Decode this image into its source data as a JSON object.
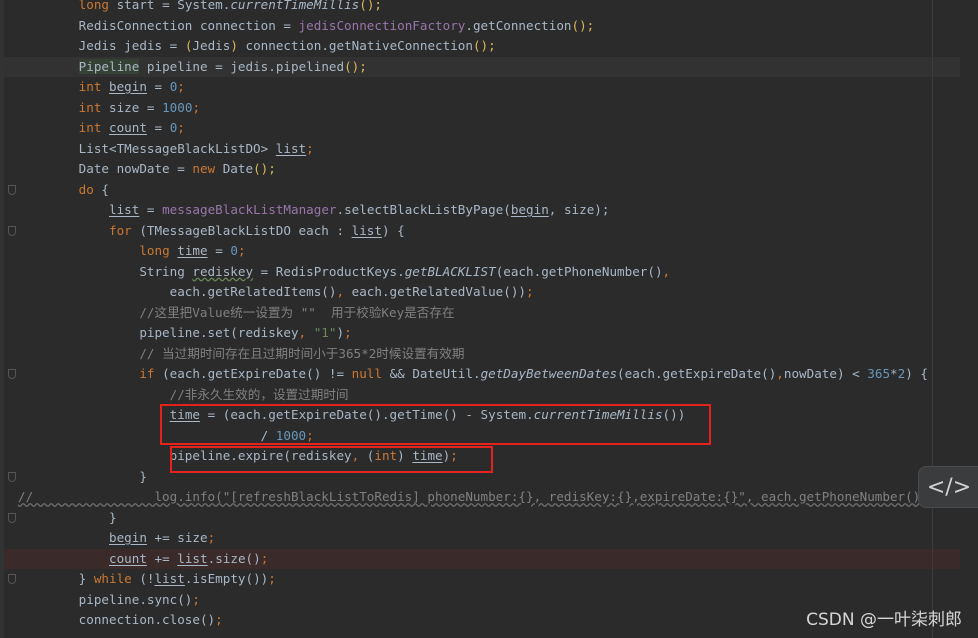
{
  "editor": {
    "lines": [
      {
        "tokens": [
          [
            "        ",
            ""
          ],
          [
            "long",
            "kw"
          ],
          [
            " start = System.",
            ""
          ],
          [
            "currentTimeMillis",
            "st"
          ],
          [
            "();",
            "br"
          ]
        ]
      },
      {
        "tokens": [
          [
            "        RedisConnection connection = ",
            ""
          ],
          [
            "jedisConnectionFactory",
            "fld"
          ],
          [
            ".getConnection",
            ""
          ],
          [
            "();",
            "br"
          ]
        ]
      },
      {
        "tokens": [
          [
            "        Jedis jedis = ",
            ""
          ],
          [
            "(",
            "br"
          ],
          [
            "Jedis",
            ""
          ],
          [
            ")",
            "br"
          ],
          [
            " connection.getNativeConnection",
            ""
          ],
          [
            "();",
            "br"
          ]
        ]
      },
      {
        "state": "cur",
        "tokens": [
          [
            "        ",
            ""
          ],
          [
            "Pipeline",
            "cls"
          ],
          [
            " pipeline = jedis.pipelined",
            ""
          ],
          [
            "();",
            "br"
          ]
        ]
      },
      {
        "tokens": [
          [
            "        ",
            ""
          ],
          [
            "int",
            "kw"
          ],
          [
            " ",
            ""
          ],
          [
            "begin",
            "var"
          ],
          [
            " = ",
            ""
          ],
          [
            "0",
            "num"
          ],
          [
            ";",
            "kw"
          ]
        ]
      },
      {
        "tokens": [
          [
            "        ",
            ""
          ],
          [
            "int",
            "kw"
          ],
          [
            " size = ",
            ""
          ],
          [
            "1000",
            "num"
          ],
          [
            ";",
            "kw"
          ]
        ]
      },
      {
        "tokens": [
          [
            "        ",
            ""
          ],
          [
            "int",
            "kw"
          ],
          [
            " ",
            ""
          ],
          [
            "count",
            "var"
          ],
          [
            " = ",
            ""
          ],
          [
            "0",
            "num"
          ],
          [
            ";",
            "kw"
          ]
        ]
      },
      {
        "tokens": [
          [
            "        List<TMessageBlackListDO> ",
            ""
          ],
          [
            "list",
            "var"
          ],
          [
            ";",
            "kw"
          ]
        ]
      },
      {
        "tokens": [
          [
            "        Date nowDate = ",
            ""
          ],
          [
            "new",
            "kw"
          ],
          [
            " Date",
            ""
          ],
          [
            "();",
            "br"
          ]
        ]
      },
      {
        "fold": true,
        "tokens": [
          [
            "        ",
            ""
          ],
          [
            "do",
            "kw"
          ],
          [
            " {",
            ""
          ]
        ]
      },
      {
        "tokens": [
          [
            "            ",
            ""
          ],
          [
            "list",
            "var"
          ],
          [
            " = ",
            ""
          ],
          [
            "messageBlackListManager",
            "fld"
          ],
          [
            ".selectBlackListByPage(",
            ""
          ],
          [
            "begin",
            "var"
          ],
          [
            ", size);",
            ""
          ]
        ]
      },
      {
        "fold": true,
        "tokens": [
          [
            "            ",
            ""
          ],
          [
            "for",
            "kw"
          ],
          [
            " (TMessageBlackListDO each : ",
            ""
          ],
          [
            "list",
            "var"
          ],
          [
            ") {",
            ""
          ]
        ]
      },
      {
        "tokens": [
          [
            "                ",
            ""
          ],
          [
            "long",
            "kw"
          ],
          [
            " ",
            ""
          ],
          [
            "time",
            "var"
          ],
          [
            " = ",
            ""
          ],
          [
            "0",
            "num"
          ],
          [
            ";",
            "kw"
          ]
        ]
      },
      {
        "tokens": [
          [
            "                String ",
            ""
          ],
          [
            "rediskey",
            "wavy"
          ],
          [
            " = RedisProductKeys.",
            ""
          ],
          [
            "getBLACKLIST",
            "st"
          ],
          [
            "(each.getPhoneNumber()",
            ""
          ],
          [
            ",",
            "kw"
          ]
        ]
      },
      {
        "tokens": [
          [
            "                    each.getRelatedItems()",
            ""
          ],
          [
            ", ",
            "kw"
          ],
          [
            "each.getRelatedValue())",
            ""
          ],
          [
            ";",
            "kw"
          ]
        ]
      },
      {
        "tokens": [
          [
            "                //这里把Value统一设置为 \"\"  用于校验Key是否存在",
            "cmt"
          ]
        ]
      },
      {
        "tokens": [
          [
            "                pipeline.set(rediskey",
            ""
          ],
          [
            ", ",
            "kw"
          ],
          [
            "\"1\"",
            "str"
          ],
          [
            ")",
            ""
          ],
          [
            ";",
            "kw"
          ]
        ]
      },
      {
        "tokens": [
          [
            "                // 当过期时间存在且过期时间小于365*2时候设置有效期",
            "cmt"
          ]
        ]
      },
      {
        "fold": true,
        "tokens": [
          [
            "                ",
            ""
          ],
          [
            "if",
            "kw"
          ],
          [
            " (each.getExpireDate() != ",
            ""
          ],
          [
            "null",
            "kw"
          ],
          [
            " && DateUtil.",
            ""
          ],
          [
            "getDayBetweenDates",
            "st"
          ],
          [
            "(each.getExpireDate()",
            ""
          ],
          [
            ",",
            "kw"
          ],
          [
            "nowDate) < ",
            ""
          ],
          [
            "365",
            "num"
          ],
          [
            "*",
            ""
          ],
          [
            "2",
            "num"
          ],
          [
            ") {",
            ""
          ]
        ]
      },
      {
        "tokens": [
          [
            "                    //非永久生效的，设置过期时间",
            "cmt"
          ]
        ]
      },
      {
        "tokens": [
          [
            "                    ",
            ""
          ],
          [
            "time",
            "var"
          ],
          [
            " = (each.getExpireDate().getTime() - System.",
            ""
          ],
          [
            "currentTimeMillis",
            "st"
          ],
          [
            "())",
            ""
          ]
        ]
      },
      {
        "tokens": [
          [
            "                                / ",
            ""
          ],
          [
            "1000",
            "num"
          ],
          [
            ";",
            "kw"
          ]
        ]
      },
      {
        "tokens": [
          [
            "                    pipeline.expire(rediskey",
            ""
          ],
          [
            ", ",
            "kw"
          ],
          [
            "(",
            ""
          ],
          [
            "int",
            "kw"
          ],
          [
            ") ",
            ""
          ],
          [
            "time",
            "var"
          ],
          [
            ")",
            ""
          ],
          [
            ";",
            "kw"
          ]
        ]
      },
      {
        "fold": true,
        "tokens": [
          [
            "                }",
            ""
          ]
        ]
      },
      {
        "comment": true,
        "tokens": [
          [
            "//                log.info(\"[refreshBlackListToRedis] phoneNumber:{}, redisKey:{},expireDate:{}\", each.getPhoneNumber(), each.getR",
            "cmt"
          ]
        ]
      },
      {
        "fold": true,
        "tokens": [
          [
            "            }",
            ""
          ]
        ]
      },
      {
        "tokens": [
          [
            "            ",
            ""
          ],
          [
            "begin",
            "var"
          ],
          [
            " += size",
            ""
          ],
          [
            ";",
            "kw"
          ]
        ]
      },
      {
        "state": "err",
        "tokens": [
          [
            "            ",
            ""
          ],
          [
            "count",
            "var"
          ],
          [
            " += ",
            ""
          ],
          [
            "list",
            "var"
          ],
          [
            ".size()",
            ""
          ],
          [
            ";",
            "kw"
          ]
        ]
      },
      {
        "fold": true,
        "tokens": [
          [
            "        } ",
            ""
          ],
          [
            "while",
            "kw"
          ],
          [
            " (!",
            ""
          ],
          [
            "list",
            "var"
          ],
          [
            ".isEmpty())",
            ""
          ],
          [
            ";",
            "kw"
          ]
        ]
      },
      {
        "tokens": [
          [
            "        pipeline.sync()",
            ""
          ],
          [
            ";",
            "kw"
          ]
        ]
      },
      {
        "tokens": [
          [
            "        connection.close()",
            ""
          ],
          [
            ";",
            "kw"
          ]
        ]
      }
    ]
  },
  "code_button": {
    "label": "</>"
  },
  "watermark": "CSDN @一叶柒刺郎",
  "colors": {
    "background": "#2b2b2b",
    "keyword": "#cc7832",
    "number": "#6897bb",
    "string": "#6a8759",
    "field": "#9876aa",
    "comment": "#808080",
    "highlight_box": "#e5221c"
  }
}
